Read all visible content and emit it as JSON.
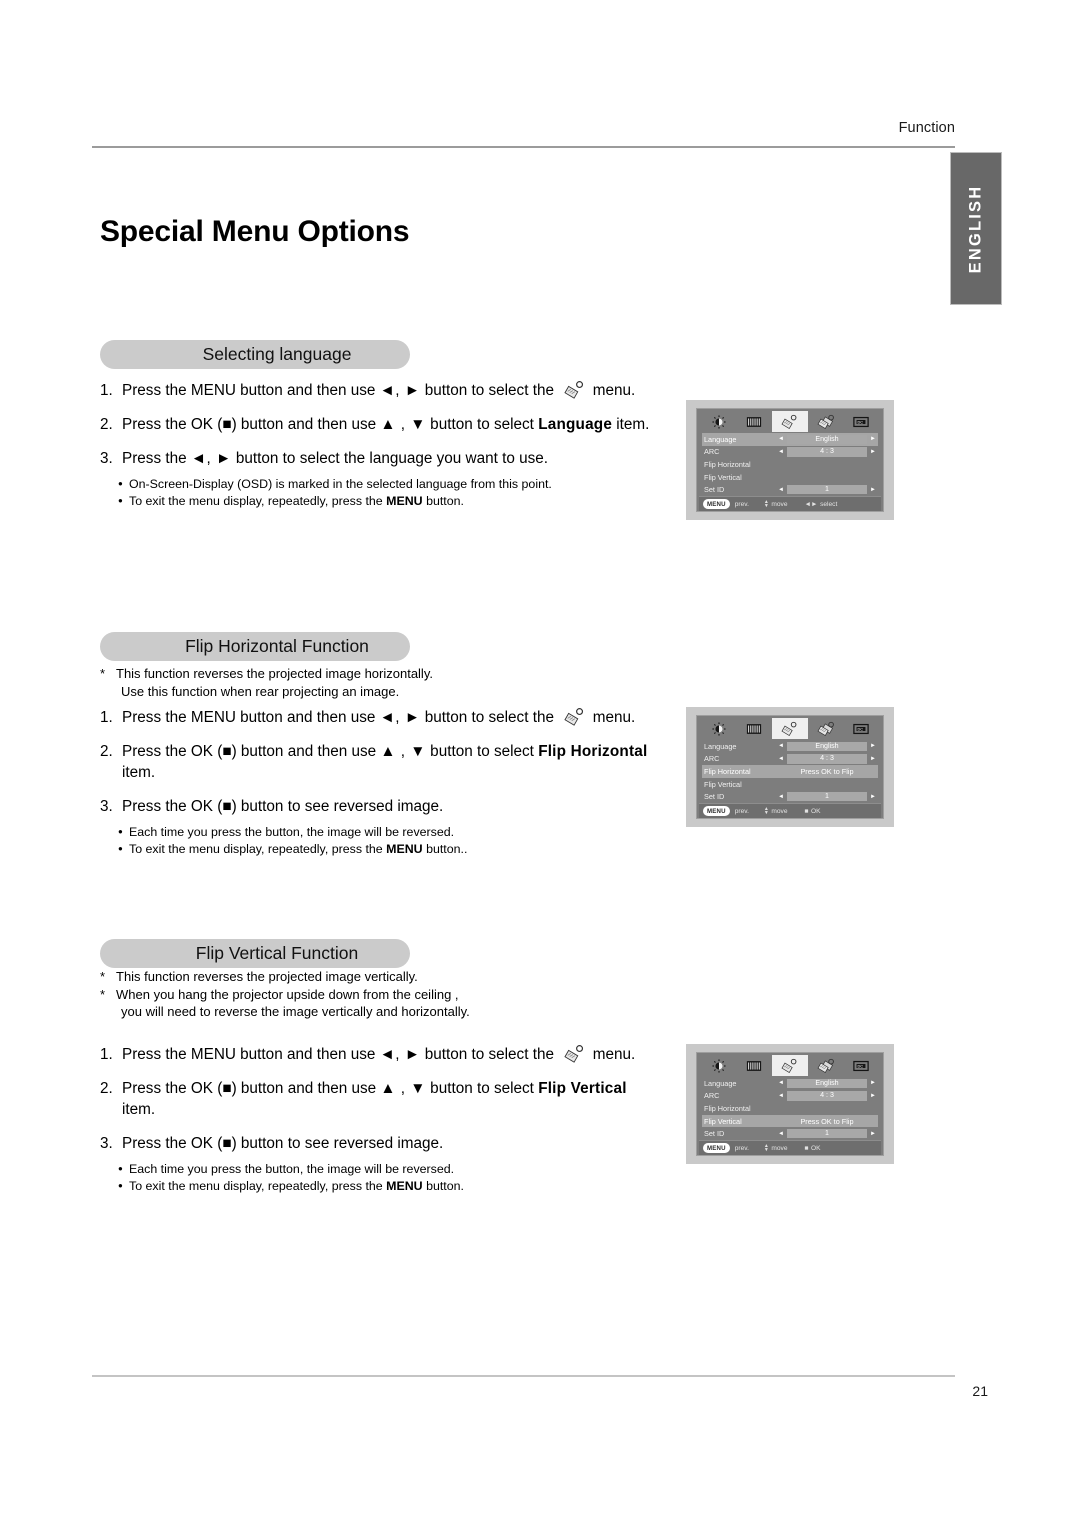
{
  "header": {
    "running_title": "Function",
    "language_tab": "ENGLISH"
  },
  "page_title": "Special Menu Options",
  "footer": {
    "page_number": "21"
  },
  "sections": [
    {
      "heading": "Selecting language",
      "notes": [],
      "steps": [
        {
          "num": "1.",
          "pre": "Press the ",
          "bold1": "MENU",
          "mid": " button and then use ",
          "arrows": "◄, ►",
          "mid2": " button to select the ",
          "icon": "tag-menu-icon",
          "post": " menu."
        },
        {
          "num": "2.",
          "pre": "Press the ",
          "bold1": "OK",
          "mid": " (■) button and then use ",
          "arrows": "▲ , ▼",
          "mid2": " button to select ",
          "bold2": "Language",
          "post": " item."
        },
        {
          "num": "3.",
          "pre": "Press the ",
          "arrows": "◄, ►",
          "mid2": " button to select the language you want to use."
        }
      ],
      "bullets": [
        "On-Screen-Display (OSD) is marked in the selected language from this point.",
        "To exit the menu display, repeatedly, press the MENU button."
      ],
      "bullet_bold": "MENU"
    },
    {
      "heading": "Flip Horizontal Function",
      "notes": [
        "This function reverses the projected image horizontally.",
        "Use this function when rear projecting an image."
      ],
      "steps": [
        {
          "num": "1.",
          "pre": "Press the ",
          "bold1": "MENU",
          "mid": " button and then use ",
          "arrows": "◄, ►",
          "mid2": " button to select the ",
          "icon": "tag-menu-icon",
          "post": " menu."
        },
        {
          "num": "2.",
          "pre": "Press the ",
          "bold1": "OK",
          "mid": " (■) button and then use ",
          "arrows": "▲ , ▼",
          "mid2": " button to select ",
          "bold2": "Flip Horizontal",
          "post": "",
          "second_line": "item."
        },
        {
          "num": "3.",
          "pre": "Press the ",
          "bold1": "OK",
          "mid": " (■) button to see reversed image."
        }
      ],
      "bullets": [
        "Each time you press the button, the image will be reversed.",
        "To exit the menu display, repeatedly, press the MENU button.."
      ],
      "bullet_bold": "MENU"
    },
    {
      "heading": "Flip Vertical Function",
      "notes": [
        "This function reverses the projected image vertically.",
        "When you hang the projector upside down from the ceiling ,",
        "you will need to reverse  the image vertically and horizontally."
      ],
      "steps": [
        {
          "num": "1.",
          "pre": "Press the ",
          "bold1": "MENU",
          "mid": " button and then use ",
          "arrows": "◄, ►",
          "mid2": " button to select the ",
          "icon": "tag-menu-icon",
          "post": " menu."
        },
        {
          "num": "2.",
          "pre": "Press the ",
          "bold1": "OK",
          "mid": " (■) button and then use ",
          "arrows": "▲ , ▼",
          "mid2": " button to select ",
          "bold2": "Flip Vertical",
          "post": "",
          "second_line": "item."
        },
        {
          "num": "3.",
          "pre": "Press the ",
          "bold1": "OK",
          "mid": " (■) button to see reversed image."
        }
      ],
      "bullets": [
        "Each time you press the button, the image will be reversed.",
        "To exit the menu display, repeatedly, press the MENU button."
      ],
      "bullet_bold": "MENU"
    }
  ],
  "osd_screens": [
    {
      "id": "osd-language",
      "tabs": [
        "brightness-icon",
        "equalizer-icon",
        "tag-icon",
        "double-tag-icon",
        "framed-icon"
      ],
      "active_tab_index": 2,
      "rows": [
        {
          "label": "Language",
          "type": "value",
          "value": "English",
          "selected": true
        },
        {
          "label": "ARC",
          "type": "value",
          "value": "4 : 3",
          "selected": false
        },
        {
          "label": "Flip Horizontal",
          "type": "none",
          "value": "",
          "selected": false
        },
        {
          "label": "Flip Vertical",
          "type": "none",
          "value": "",
          "selected": false
        },
        {
          "label": "Set ID",
          "type": "value",
          "value": "1",
          "selected": false
        }
      ],
      "statusbar": {
        "menu_chip": "MENU",
        "prev": "prev.",
        "move": "move",
        "action": "select",
        "action_icon": "left-right-arrows"
      }
    },
    {
      "id": "osd-flip-horizontal",
      "tabs": [
        "brightness-icon",
        "equalizer-icon",
        "tag-icon",
        "double-tag-icon",
        "framed-icon"
      ],
      "active_tab_index": 2,
      "rows": [
        {
          "label": "Language",
          "type": "value",
          "value": "English",
          "selected": false
        },
        {
          "label": "ARC",
          "type": "value",
          "value": "4 : 3",
          "selected": false
        },
        {
          "label": "Flip Horizontal",
          "type": "message",
          "value": "Press OK to Flip",
          "selected": true
        },
        {
          "label": "Flip Vertical",
          "type": "none",
          "value": "",
          "selected": false
        },
        {
          "label": "Set ID",
          "type": "value",
          "value": "1",
          "selected": false
        }
      ],
      "statusbar": {
        "menu_chip": "MENU",
        "prev": "prev.",
        "move": "move",
        "action": "OK",
        "action_icon": "square-icon"
      }
    },
    {
      "id": "osd-flip-vertical",
      "tabs": [
        "brightness-icon",
        "equalizer-icon",
        "tag-icon",
        "double-tag-icon",
        "framed-icon"
      ],
      "active_tab_index": 2,
      "rows": [
        {
          "label": "Language",
          "type": "value",
          "value": "English",
          "selected": false
        },
        {
          "label": "ARC",
          "type": "value",
          "value": "4 : 3",
          "selected": false
        },
        {
          "label": "Flip Horizontal",
          "type": "none",
          "value": "",
          "selected": false
        },
        {
          "label": "Flip Vertical",
          "type": "message",
          "value": "Press OK to Flip",
          "selected": true
        },
        {
          "label": "Set ID",
          "type": "value",
          "value": "1",
          "selected": false
        }
      ],
      "statusbar": {
        "menu_chip": "MENU",
        "prev": "prev.",
        "move": "move",
        "action": "OK",
        "action_icon": "square-icon"
      }
    }
  ]
}
